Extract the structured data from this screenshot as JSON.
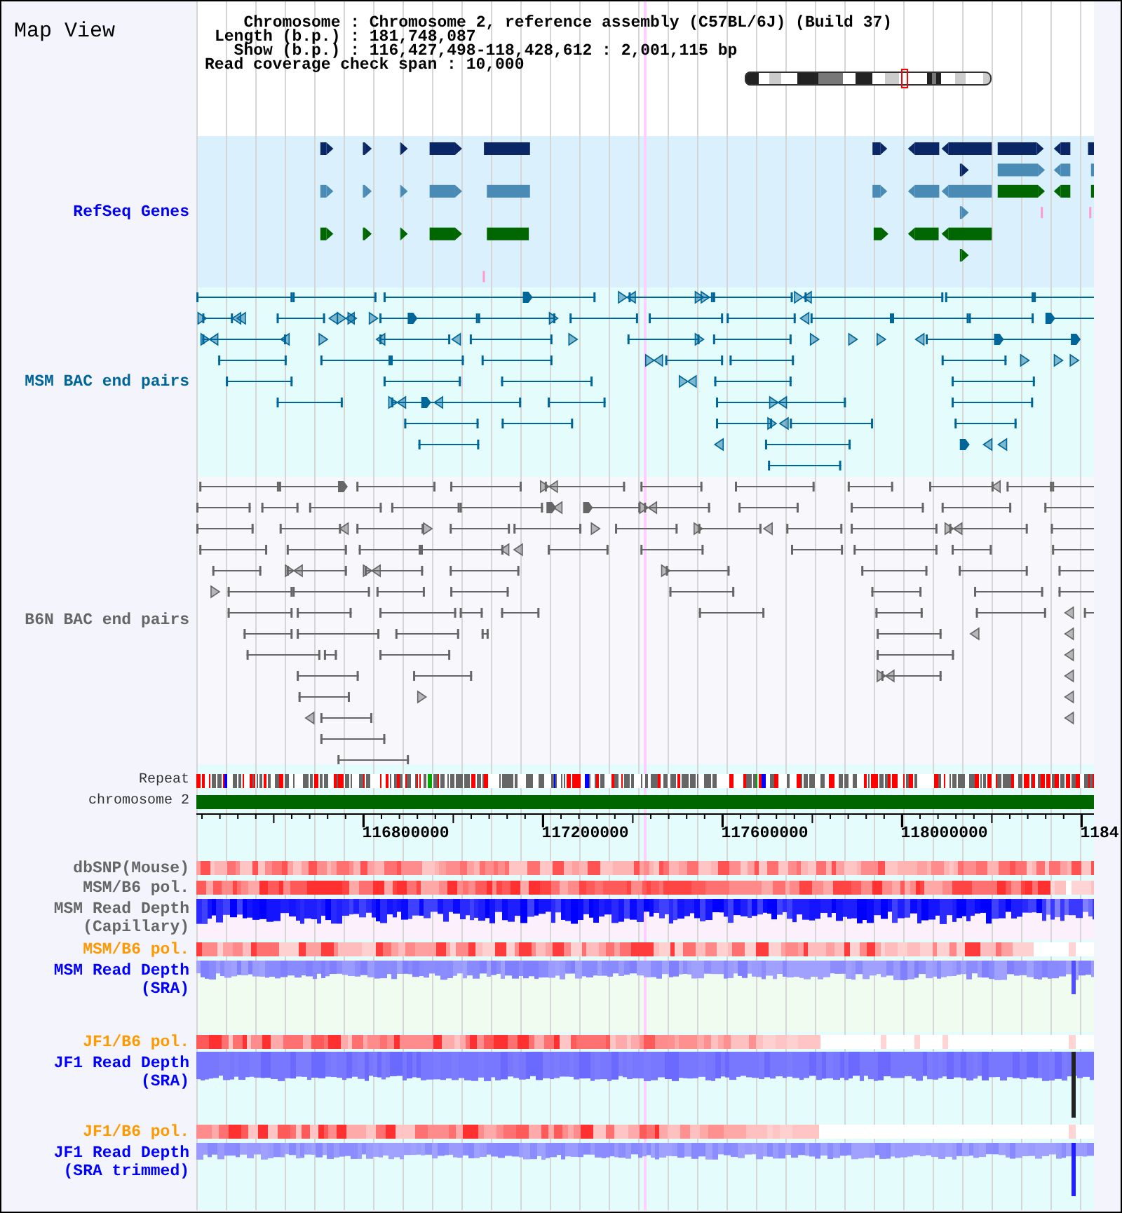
{
  "view": {
    "title": "Map View"
  },
  "summary": [
    {
      "label": "Chromosome",
      "separator": ":",
      "value": "Chromosome 2, reference assembly (C57BL/6J) (Build 37)"
    },
    {
      "label": "Length (b.p.)",
      "separator": ":",
      "value": "181,748,087"
    },
    {
      "label": "Show (b.p.)",
      "separator": ":",
      "value": "116,427,498-118,428,612 : 2,001,115 bp"
    }
  ],
  "coverage_span": {
    "label": "Read coverage check span",
    "separator": ":",
    "value": "10,000"
  },
  "tracks": [
    {
      "kind": "genes",
      "label": "RefSeq Genes",
      "color": "#0000ee"
    },
    {
      "kind": "bac_pairs",
      "label": "MSM BAC end pairs",
      "color": "#006699"
    },
    {
      "kind": "bac_pairs",
      "label": "B6N BAC end pairs",
      "color": "#666666"
    },
    {
      "kind": "repeat",
      "label": "Repeat",
      "color": "#333333"
    },
    {
      "kind": "chromosome",
      "label": "chromosome 2",
      "color": "#333333"
    },
    {
      "kind": "axis",
      "tick_labels": [
        "116800000",
        "117200000",
        "117600000",
        "118000000",
        "1184"
      ]
    },
    {
      "kind": "heat",
      "label": "dbSNP(Mouse)",
      "color": "#666666"
    },
    {
      "kind": "heat",
      "label": "MSM/B6 pol.",
      "color": "#666666"
    },
    {
      "kind": "depth",
      "label": "MSM Read Depth (Capillary)",
      "color": "#666666"
    },
    {
      "kind": "heat",
      "label": "MSM/B6 pol.",
      "color": "#ff9900"
    },
    {
      "kind": "depth",
      "label": "MSM Read Depth (SRA)",
      "color": "#0000ff"
    },
    {
      "kind": "heat",
      "label": "JF1/B6 pol.",
      "color": "#ff9900"
    },
    {
      "kind": "depth",
      "label": "JF1 Read Depth (SRA)",
      "color": "#0000ff"
    },
    {
      "kind": "heat",
      "label": "JF1/B6 pol.",
      "color": "#ff9900"
    },
    {
      "kind": "depth",
      "label": "JF1 Read Depth (SRA trimmed)",
      "color": "#0000ff"
    }
  ]
}
